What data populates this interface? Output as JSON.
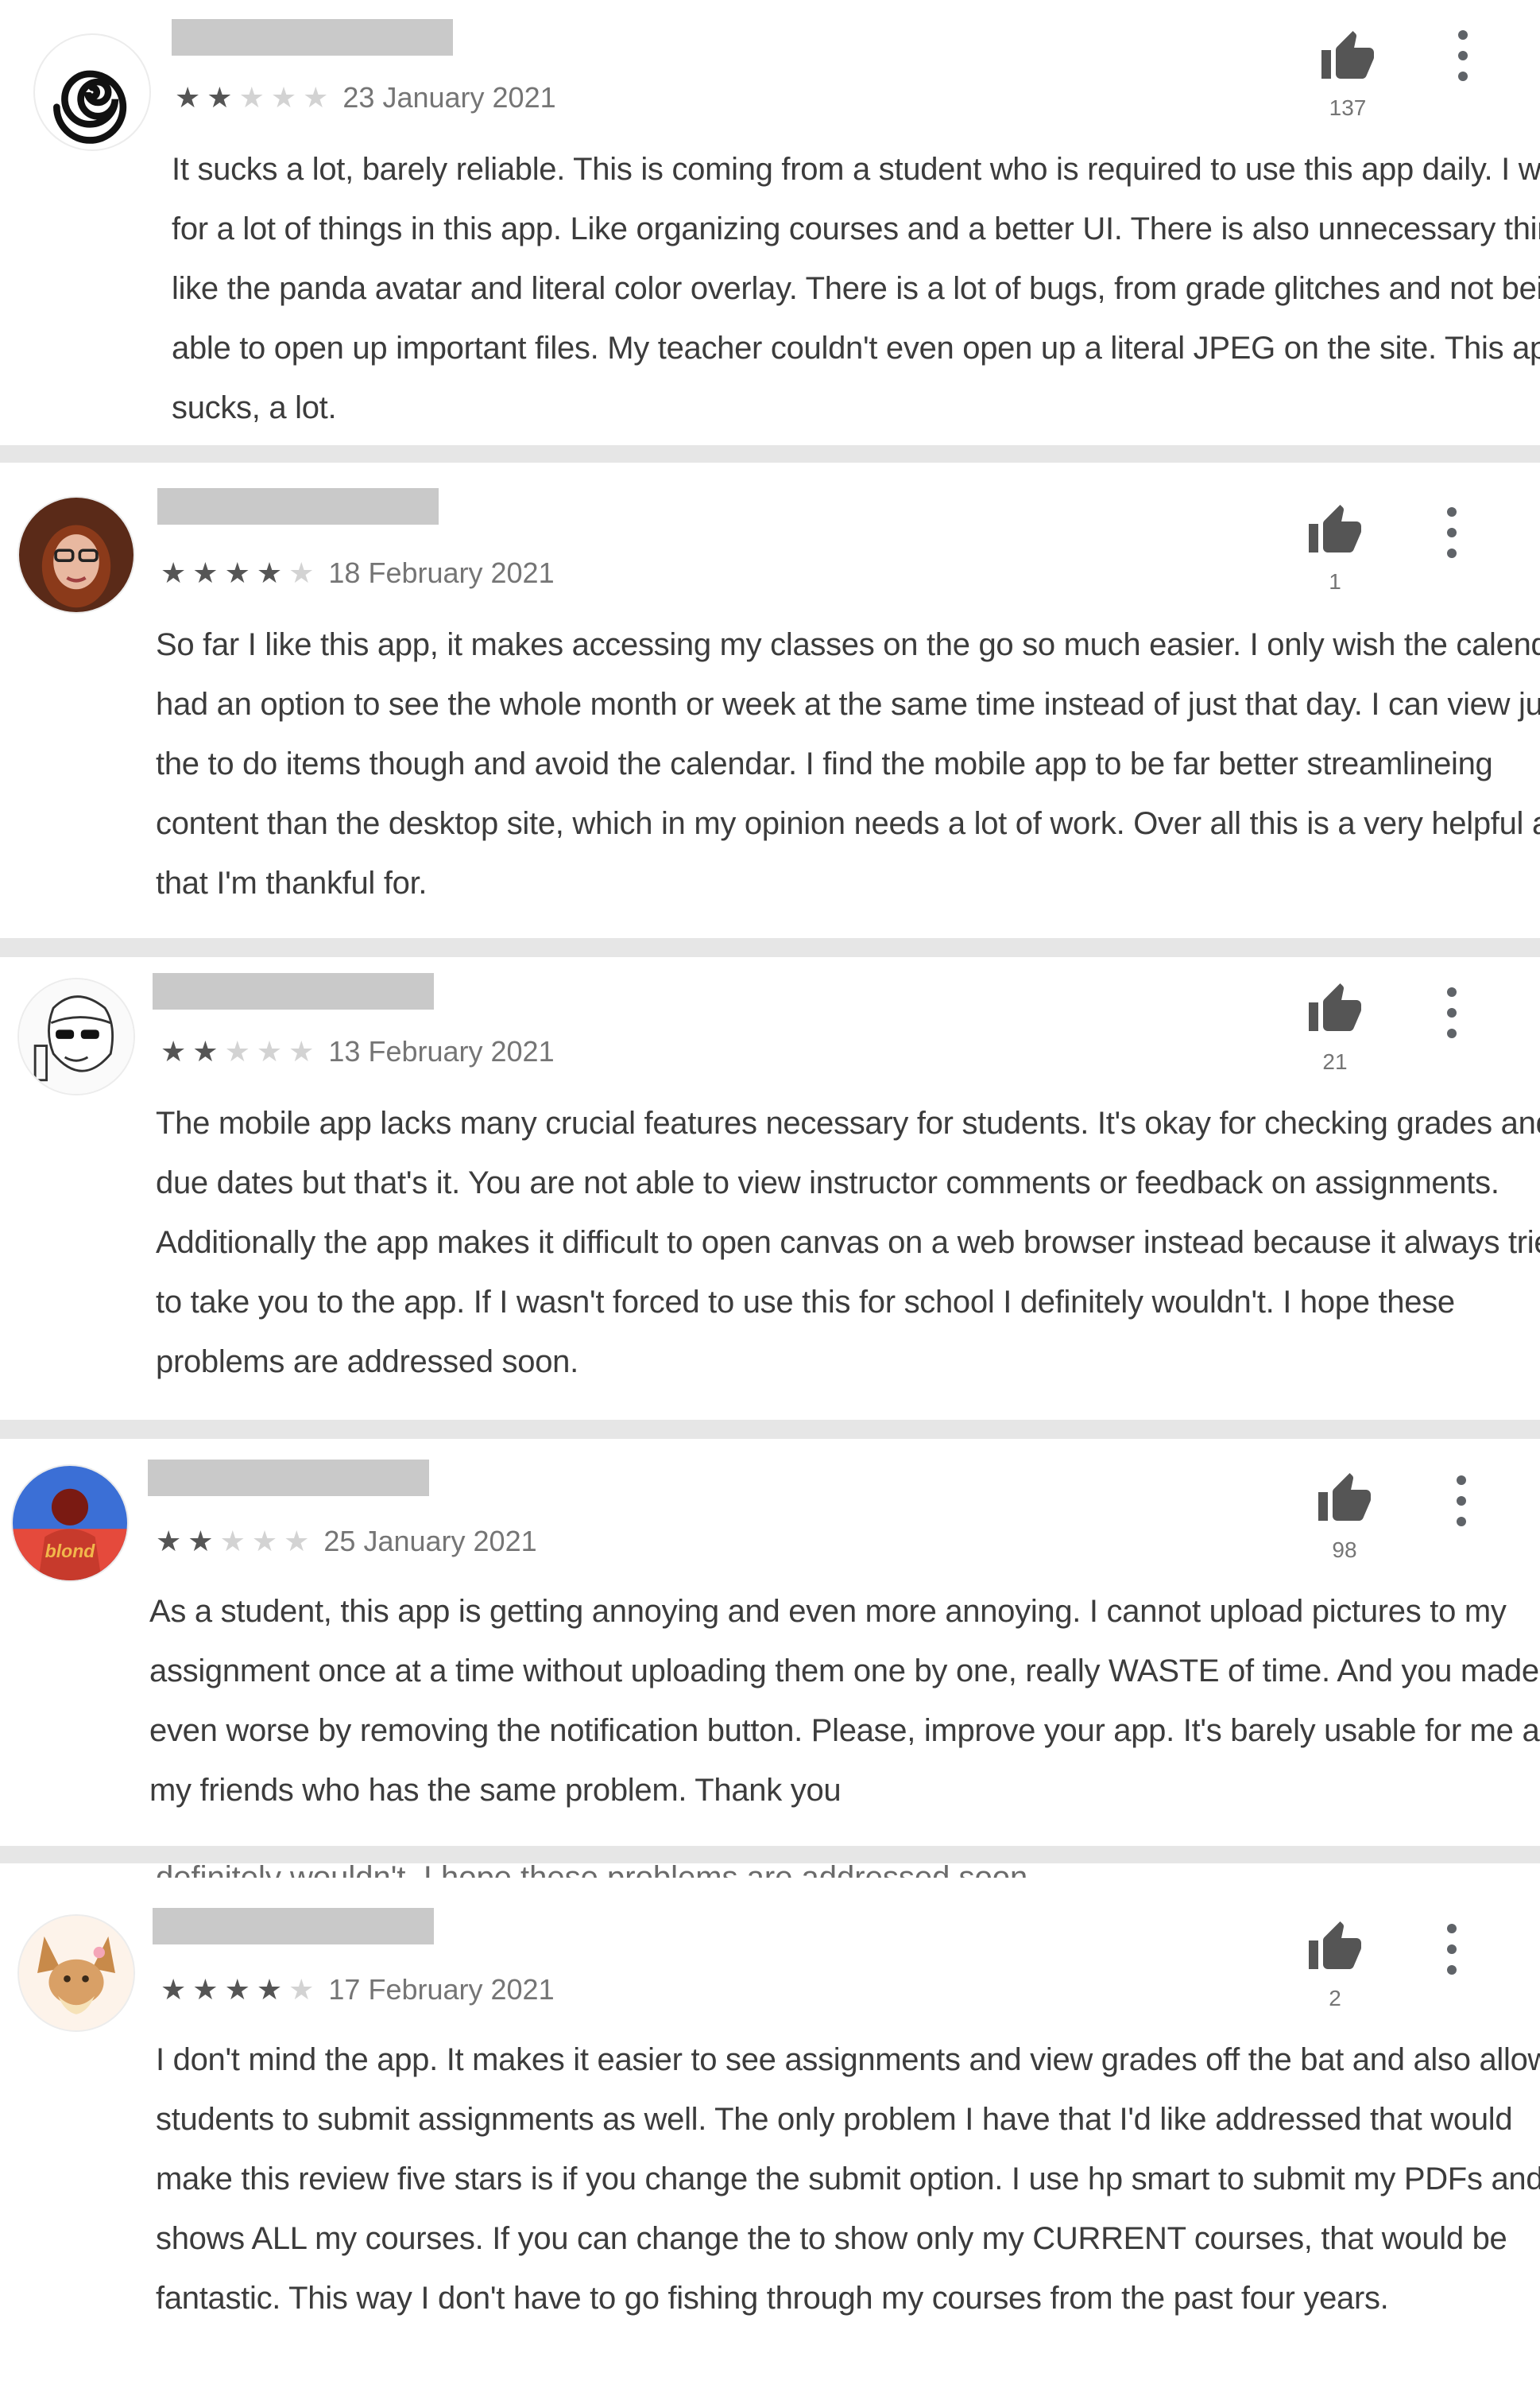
{
  "reviews": [
    {
      "stars": "★★★★★",
      "rating": 2,
      "date": "23 January 2021",
      "helpful_count": "137",
      "text": "It sucks a lot, barely reliable. This is coming from a student who is required to use this app daily. I wish for a lot of things in this app. Like organizing courses and a better UI. There is also unnecessary things like the panda avatar and literal color overlay. There is a lot of bugs, from grade glitches and not being able to open up important files. My teacher couldn't even open up a literal JPEG on the site. This app sucks, a lot."
    },
    {
      "stars": "★★★★★",
      "rating": 4,
      "date": "18 February 2021",
      "helpful_count": "1",
      "text": "So far I like this app, it makes accessing my classes on the go so much easier. I only wish the calendar had an option to see the whole month or week at the same time instead of just that day. I can view just the to do items though and avoid the calendar. I find the mobile app to be far better streamlineing content than the desktop site, which in my opinion needs a lot of work. Over all this is a very helpful app that I'm thankful for."
    },
    {
      "stars": "★★★★★",
      "rating": 2,
      "date": "13 February 2021",
      "helpful_count": "21",
      "text": "The mobile app lacks many crucial features necessary for students. It's okay for checking grades and due dates but that's it. You are not able to view instructor comments or feedback on assignments. Additionally the app makes it difficult to open canvas on a web browser instead because it always tries to take you to the app. If I wasn't forced to use this for school I definitely wouldn't. I hope these problems are addressed soon."
    },
    {
      "stars": "★★★★★",
      "rating": 2,
      "date": "25 January 2021",
      "helpful_count": "98",
      "text": "As a student, this app is getting annoying and even more annoying. I cannot upload pictures to my assignment once at a time without uploading them one by one, really WASTE of time. And you made it even worse by removing the notification button. Please, improve your app. It's barely usable for me and my friends who has the same problem. Thank you",
      "avatar_text": "blond"
    },
    {
      "stars": "★★★★★",
      "rating": 4,
      "date": "17 February 2021",
      "helpful_count": "2",
      "text": "I don't mind the app. It makes it easier to see assignments and view grades off the bat and also allows students to submit assignments as well. The only problem I have that I'd like addressed that would make this review five stars is if you change the submit option. I use hp smart to submit my PDFs and it shows ALL my courses. If you can change the to show only my CURRENT courses, that would be fantastic. This way I don't have to go fishing through my courses from the past four years."
    }
  ],
  "overlap_text": "definitely wouldn't. I hope these problems are addressed soon.",
  "colors": {
    "star_on": "#555555",
    "star_off": "#d3d3d3",
    "name_redacted": "#c9c9c9",
    "divider": "#e6e6e6"
  },
  "icons": [
    "spiral-avatar-icon",
    "thumbs-up-icon",
    "more-options-icon"
  ]
}
